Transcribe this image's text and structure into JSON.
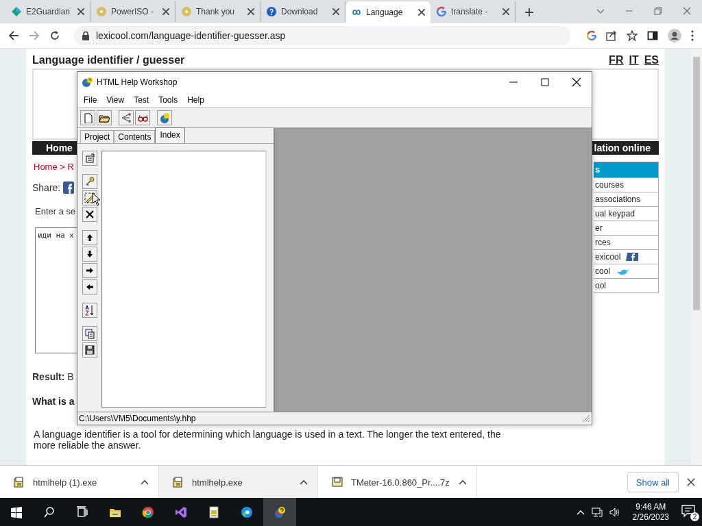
{
  "browser": {
    "tabs": [
      {
        "title": "E2Guardian",
        "selected": false
      },
      {
        "title": "PowerISO -",
        "selected": false
      },
      {
        "title": "Thank you",
        "selected": false
      },
      {
        "title": "Download",
        "selected": false
      },
      {
        "title": "Language",
        "selected": true
      },
      {
        "title": "translate -",
        "selected": false
      }
    ],
    "url": "lexicool.com/language-identifier-guesser.asp"
  },
  "page": {
    "title": "Language identifier / guesser",
    "languages": [
      "FR",
      "IT",
      "ES"
    ],
    "nav": [
      "Home",
      "lation online"
    ],
    "breadcrumb": "Home > R",
    "share_label": "Share:",
    "prompt": "Enter a se",
    "input_value": "иди на х",
    "result_label": "Result:",
    "result_value": "B",
    "question": "What is a",
    "paragraph": "A language identifier is a tool for determining which language is used in a text. The longer the text entered, the more reliable the answer.",
    "sidebar": {
      "header": "s",
      "items": [
        "courses",
        "associations",
        "ual keypad",
        "er",
        "rces",
        "exicool",
        "cool",
        "ool"
      ]
    }
  },
  "app_window": {
    "title": "HTML Help Workshop",
    "menu": [
      "File",
      "View",
      "Test",
      "Tools",
      "Help"
    ],
    "tabs": [
      {
        "label": "Project",
        "selected": false
      },
      {
        "label": "Contents",
        "selected": false
      },
      {
        "label": "Index",
        "selected": true
      }
    ],
    "status_bar": "C:\\Users\\VM5\\Documents\\y.hhp"
  },
  "downloads": {
    "items": [
      {
        "name": "htmlhelp (1).exe",
        "selected": false
      },
      {
        "name": "htmlhelp.exe",
        "selected": true
      },
      {
        "name": "TMeter-16.0.860_Pr....7z",
        "selected": false
      }
    ],
    "show_all": "Show all"
  },
  "taskbar": {
    "time": "9:46 AM",
    "date": "2/26/2023",
    "notifications": "2"
  }
}
